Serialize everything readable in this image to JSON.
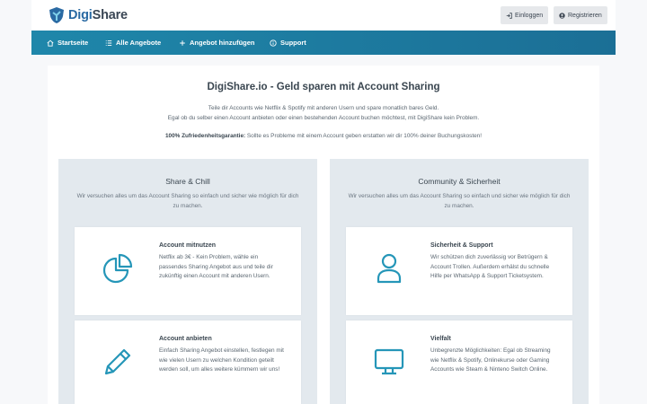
{
  "brand": {
    "part1": "Digi",
    "part2": "Share"
  },
  "auth": {
    "login_label": "Einloggen",
    "register_label": "Registrieren"
  },
  "nav": [
    {
      "label": "Startseite",
      "icon": "home-icon"
    },
    {
      "label": "Alle Angebote",
      "icon": "list-icon"
    },
    {
      "label": "Angebot hinzufügen",
      "icon": "plus-icon"
    },
    {
      "label": "Support",
      "icon": "info-icon"
    }
  ],
  "hero": {
    "title": "DigiShare.io - Geld sparen mit Account Sharing",
    "line1": "Teile dir Accounts wie Netflix & Spotify mit anderen Usern und spare monatlich bares Geld.",
    "line2": "Egal ob du selber einen Account anbieten oder einen bestehenden Account buchen möchtest, mit DigiShare kein Problem.",
    "guarantee_bold": "100% Zufriedenheitsgarantie:",
    "guarantee_text": " Sollte es Probleme mit einem Account geben erstatten wir dir 100% deiner Buchungskosten!"
  },
  "panels": [
    {
      "title": "Share & Chill",
      "subtitle": "Wir versuchen alles um das Account Sharing so einfach und sicher wie möglich für dich zu machen.",
      "cards": [
        {
          "icon": "pie-chart-icon",
          "title": "Account mitnutzen",
          "text": "Netflix ab 3€ - Kein Problem, wähle ein passendes Sharing Angebot aus und teile dir zukünftig einen Account mit anderen Usern."
        },
        {
          "icon": "pencil-icon",
          "title": "Account anbieten",
          "text": "Einfach Sharing Angebot einstellen, festlegen mit wie vielen Usern zu welchen Kondition geteilt werden soll, um alles weitere kümmern wir uns!"
        }
      ]
    },
    {
      "title": "Community & Sicherheit",
      "subtitle": "Wir versuchen alles um das Account Sharing so einfach und sicher wie möglich für dich zu machen.",
      "cards": [
        {
          "icon": "user-icon",
          "title": "Sicherheit & Support",
          "text": "Wir schützen dich zuverlässig vor Betrügern & Account Trollen. Außerdem erhälst du schnelle Hilfe per WhatsApp & Support Ticketsystem."
        },
        {
          "icon": "monitor-icon",
          "title": "Vielfalt",
          "text": "Unbegrenzte Möglichkeiten: Egal ob Streaming wie Netflix & Spotify, Onlinekurse oder Gaming Accounts wie Steam & Ninteno Switch Online."
        }
      ]
    }
  ],
  "colors": {
    "accent": "#1f87aa",
    "icon": "#2596b8",
    "panel_bg": "#e3e9ee"
  }
}
